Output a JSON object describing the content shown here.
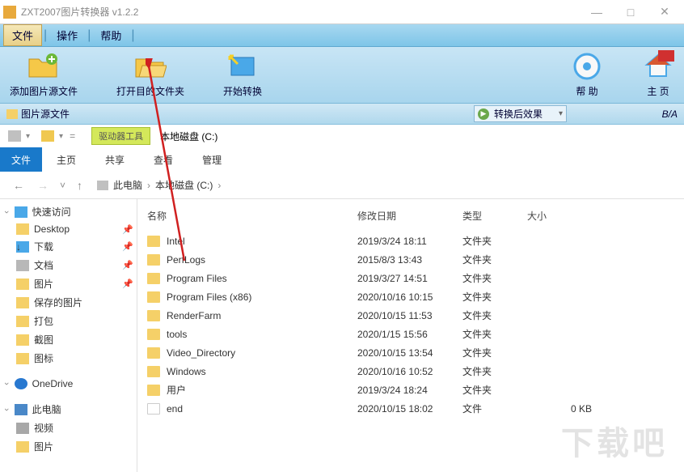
{
  "window": {
    "title": "ZXT2007图片转换器 v1.2.2",
    "min": "—",
    "max": "□",
    "close": "✕"
  },
  "menubar": {
    "file": "文件",
    "action": "操作",
    "help": "帮助"
  },
  "toolbar": {
    "add_source": "添加图片源文件",
    "open_folder": "打开目的文件夹",
    "start": "开始转换",
    "help": "帮 助",
    "home": "主 页"
  },
  "status": {
    "left_label": "图片源文件",
    "dropdown": "转换后效果",
    "ba": "B/A"
  },
  "explorer": {
    "tabs": {
      "file": "文件",
      "home": "主页",
      "share": "共享",
      "view": "查看",
      "tools_pill": "驱动器工具",
      "tools_sub": "管理"
    },
    "drive_label": "本地磁盘 (C:)",
    "breadcrumb": {
      "up": "↑",
      "pc": "此电脑",
      "drive": "本地磁盘 (C:)"
    },
    "sidebar": {
      "quick": "快速访问",
      "desktop": "Desktop",
      "downloads": "下载",
      "documents": "文档",
      "pictures": "图片",
      "saved_pics": "保存的图片",
      "package": "打包",
      "screenshots": "截图",
      "icons": "图标",
      "onedrive": "OneDrive",
      "thispc": "此电脑",
      "video": "视频",
      "pictures2": "图片"
    },
    "columns": {
      "name": "名称",
      "date": "修改日期",
      "type": "类型",
      "size": "大小"
    },
    "files": [
      {
        "name": "Intel",
        "date": "2019/3/24 18:11",
        "type": "文件夹",
        "size": "",
        "icon": "folder"
      },
      {
        "name": "PerfLogs",
        "date": "2015/8/3 13:43",
        "type": "文件夹",
        "size": "",
        "icon": "folder"
      },
      {
        "name": "Program Files",
        "date": "2019/3/27 14:51",
        "type": "文件夹",
        "size": "",
        "icon": "folder"
      },
      {
        "name": "Program Files (x86)",
        "date": "2020/10/16 10:15",
        "type": "文件夹",
        "size": "",
        "icon": "folder"
      },
      {
        "name": "RenderFarm",
        "date": "2020/10/15 11:53",
        "type": "文件夹",
        "size": "",
        "icon": "folder"
      },
      {
        "name": "tools",
        "date": "2020/1/15 15:56",
        "type": "文件夹",
        "size": "",
        "icon": "folder"
      },
      {
        "name": "Video_Directory",
        "date": "2020/10/15 13:54",
        "type": "文件夹",
        "size": "",
        "icon": "folder"
      },
      {
        "name": "Windows",
        "date": "2020/10/16 10:52",
        "type": "文件夹",
        "size": "",
        "icon": "folder"
      },
      {
        "name": "用户",
        "date": "2019/3/24 18:24",
        "type": "文件夹",
        "size": "",
        "icon": "folder"
      },
      {
        "name": "end",
        "date": "2020/10/15 18:02",
        "type": "文件",
        "size": "0 KB",
        "icon": "file"
      }
    ]
  },
  "watermark": "下载吧"
}
